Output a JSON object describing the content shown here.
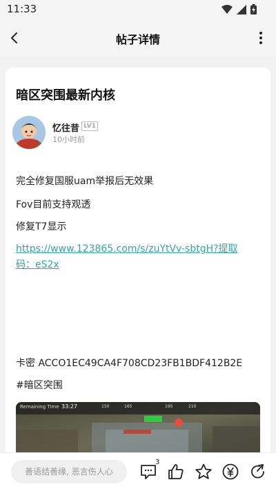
{
  "status": {
    "time": "11:33"
  },
  "header": {
    "title": "帖子详情"
  },
  "post": {
    "title": "暗区突围最新内核",
    "author": {
      "name": "忆往昔",
      "level": "LV1",
      "time": "10小时前"
    },
    "lines": [
      "完全修复国服uam举报后无效果",
      "Fov目前支持观透",
      "修复T7显示"
    ],
    "link": "https://www.123865.com/s/zuYtVv-sbtgH?提取码：eS2x",
    "card_key": "卡密 ACCO1EC49CA4F708CD23FB1BDF412B2E",
    "hashtag": "#暗区突围",
    "screenshot_hud": {
      "label": "Remaining Time",
      "time": "33:27",
      "compass": [
        "150",
        "165",
        "195",
        "210"
      ]
    }
  },
  "bottom": {
    "comment_placeholder": "善语结善缘, 恶言伤人心",
    "comment_count": "3"
  },
  "icons": [
    "back-icon",
    "more-icon",
    "comment-icon",
    "like-icon",
    "star-icon",
    "yen-icon",
    "share-icon"
  ]
}
